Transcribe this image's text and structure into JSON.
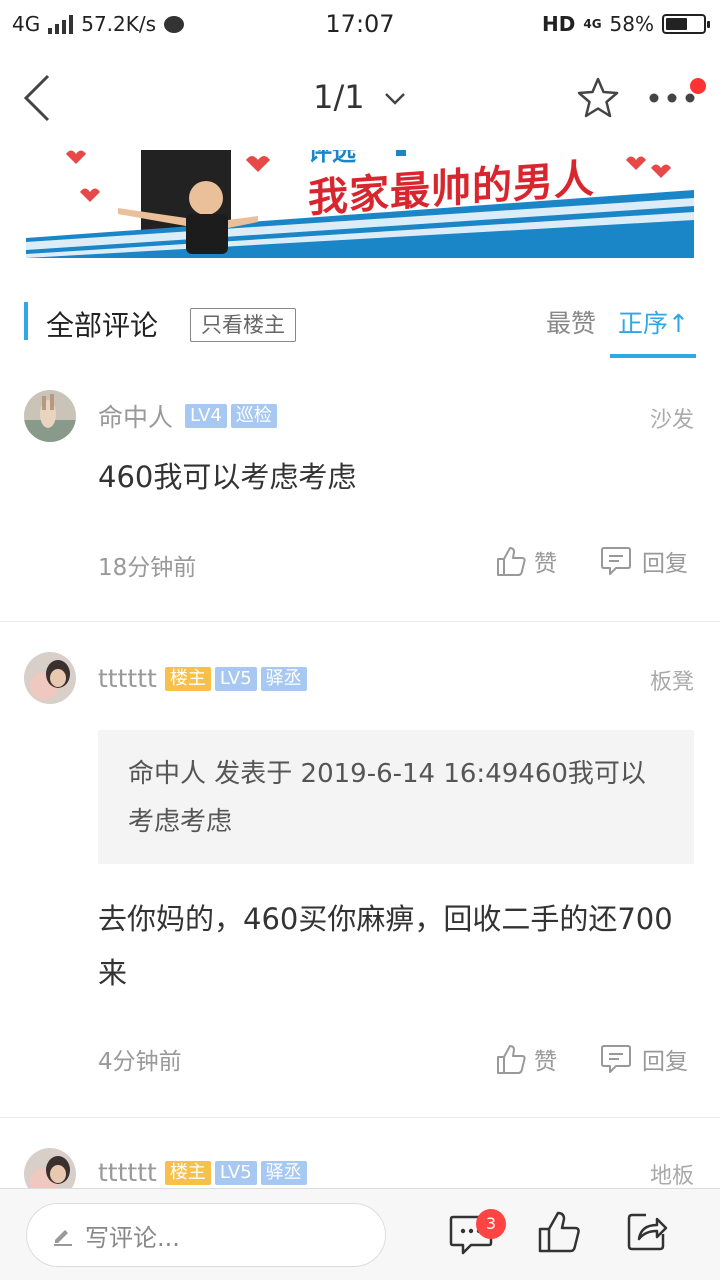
{
  "status_bar": {
    "network": "4G",
    "speed": "57.2K/s",
    "time": "17:07",
    "hd_label": "HD",
    "hd_net": "4G",
    "battery": "58%",
    "battery_level": 0.58
  },
  "nav": {
    "page_indicator": "1/1"
  },
  "banner": {
    "text": "我家最帅的男人",
    "partial_text": "评选"
  },
  "comments_header": {
    "title": "全部评论",
    "only_op": "只看楼主",
    "sort_best": "最赞",
    "sort_order": "正序↑"
  },
  "comments": [
    {
      "user": "命中人",
      "badges": {
        "level": "LV4",
        "role": "巡检"
      },
      "floor": "沙发",
      "text": "460我可以考虑考虑",
      "time": "18分钟前",
      "like_label": "赞",
      "reply_label": "回复"
    },
    {
      "user": "tttttt",
      "badges": {
        "op": "楼主",
        "level": "LV5",
        "role": "驿丞"
      },
      "floor": "板凳",
      "quote": "命中人 发表于 2019-6-14 16:49460我可以考虑考虑",
      "text": "去你妈的，460买你麻痹，回收二手的还700来",
      "time": "4分钟前",
      "like_label": "赞",
      "reply_label": "回复"
    },
    {
      "user": "tttttt",
      "badges": {
        "op": "楼主",
        "level": "LV5",
        "role": "驿丞"
      },
      "floor": "地板"
    }
  ],
  "bottom_bar": {
    "write_placeholder": "写评论...",
    "comment_count": "3"
  },
  "colors": {
    "accent": "#2ea8e8",
    "op_tag": "#f7c04a",
    "level_tag": "#a7c8f0",
    "badge": "#ff4444"
  }
}
